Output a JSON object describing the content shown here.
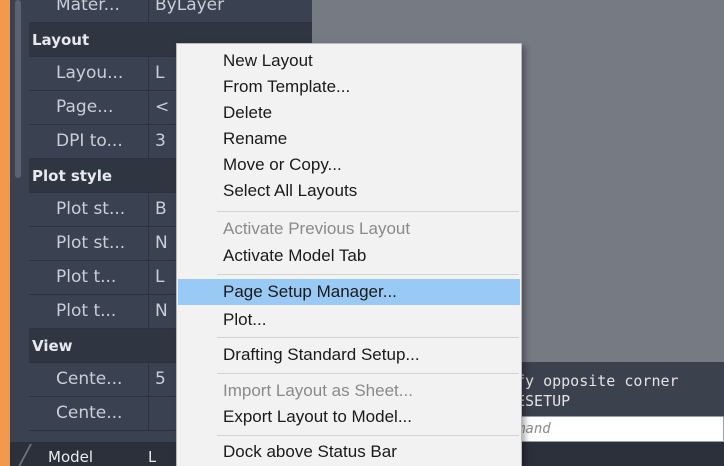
{
  "palette": {
    "rows": [
      {
        "type": "prop",
        "key": "Mater...",
        "value": "ByLayer"
      },
      {
        "type": "header",
        "label": "Layout"
      },
      {
        "type": "prop",
        "key": "Layou...",
        "value": "L"
      },
      {
        "type": "prop",
        "key": "Page...",
        "value": "<"
      },
      {
        "type": "prop",
        "key": "DPI to...",
        "value": "3"
      },
      {
        "type": "header",
        "label": "Plot style"
      },
      {
        "type": "prop",
        "key": "Plot st...",
        "value": "B"
      },
      {
        "type": "prop",
        "key": "Plot st...",
        "value": "N"
      },
      {
        "type": "prop",
        "key": "Plot t...",
        "value": "L"
      },
      {
        "type": "prop",
        "key": "Plot t...",
        "value": "N"
      },
      {
        "type": "header",
        "label": "View"
      },
      {
        "type": "prop",
        "key": "Cente...",
        "value": "5"
      },
      {
        "type": "prop",
        "key": "Cente...",
        "value": ""
      }
    ]
  },
  "context_menu": {
    "items": [
      {
        "label": "New Layout",
        "disabled": false
      },
      {
        "label": "From Template...",
        "disabled": false
      },
      {
        "label": "Delete",
        "disabled": false
      },
      {
        "label": "Rename",
        "disabled": false
      },
      {
        "label": "Move or Copy...",
        "disabled": false
      },
      {
        "label": "Select All Layouts",
        "disabled": false
      },
      {
        "label": "Activate Previous Layout",
        "disabled": true
      },
      {
        "label": "Activate Model Tab",
        "disabled": false
      },
      {
        "label": "Page Setup Manager...",
        "disabled": false,
        "highlighted": true
      },
      {
        "label": "Plot...",
        "disabled": false
      },
      {
        "label": "Drafting Standard Setup...",
        "disabled": false
      },
      {
        "label": "Import Layout as Sheet...",
        "disabled": true
      },
      {
        "label": "Export Layout to Model...",
        "disabled": false
      },
      {
        "label": "Dock above Status Bar",
        "disabled": false
      }
    ]
  },
  "command_line": {
    "history": [
      "fy opposite corner",
      "ESETUP"
    ],
    "placeholder": "mand"
  },
  "tabs": {
    "model": "Model",
    "layout1": "L"
  },
  "colors": {
    "frame_accent": "#f29a4b",
    "palette_bg": "#3a4150",
    "menu_highlight": "#99c9f5",
    "drawing_area": "#757a83"
  }
}
